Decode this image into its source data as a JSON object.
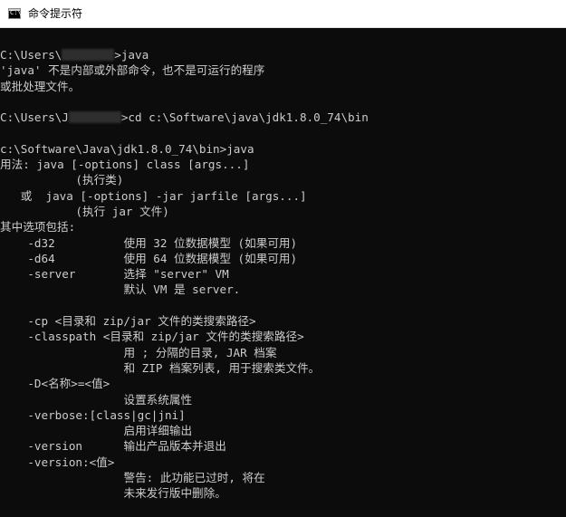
{
  "window": {
    "title": "命令提示符",
    "icon": "cmd-icon",
    "icon_glyph": "C:\\",
    "colors": {
      "titlebar_bg": "#ffffff",
      "console_bg": "#0c0c0c",
      "console_text": "#cccccc"
    }
  },
  "console": {
    "lines": [
      {
        "before": "C:\\Users\\",
        "after": ">java"
      },
      {
        "text": "'java' 不是内部或外部命令，也不是可运行的程序"
      },
      {
        "text": "或批处理文件。"
      },
      {
        "text": ""
      },
      {
        "before": "C:\\Users\\J",
        "after": ">cd c:\\Software\\java\\jdk1.8.0_74\\bin"
      },
      {
        "text": ""
      },
      {
        "text": "c:\\Software\\Java\\jdk1.8.0_74\\bin>java"
      },
      {
        "text": "用法: java [-options] class [args...]"
      },
      {
        "text": "           (执行类)"
      },
      {
        "text": "   或  java [-options] -jar jarfile [args...]"
      },
      {
        "text": "           (执行 jar 文件)"
      },
      {
        "text": "其中选项包括:"
      },
      {
        "text": "    -d32          使用 32 位数据模型 (如果可用)"
      },
      {
        "text": "    -d64          使用 64 位数据模型 (如果可用)"
      },
      {
        "text": "    -server       选择 \"server\" VM"
      },
      {
        "text": "                  默认 VM 是 server."
      },
      {
        "text": ""
      },
      {
        "text": "    -cp <目录和 zip/jar 文件的类搜索路径>"
      },
      {
        "text": "    -classpath <目录和 zip/jar 文件的类搜索路径>"
      },
      {
        "text": "                  用 ; 分隔的目录, JAR 档案"
      },
      {
        "text": "                  和 ZIP 档案列表, 用于搜索类文件。"
      },
      {
        "text": "    -D<名称>=<值>"
      },
      {
        "text": "                  设置系统属性"
      },
      {
        "text": "    -verbose:[class|gc|jni]"
      },
      {
        "text": "                  启用详细输出"
      },
      {
        "text": "    -version      输出产品版本并退出"
      },
      {
        "text": "    -version:<值>"
      },
      {
        "text": "                  警告: 此功能已过时, 将在"
      },
      {
        "text": "                  未来发行版中删除。"
      }
    ]
  }
}
